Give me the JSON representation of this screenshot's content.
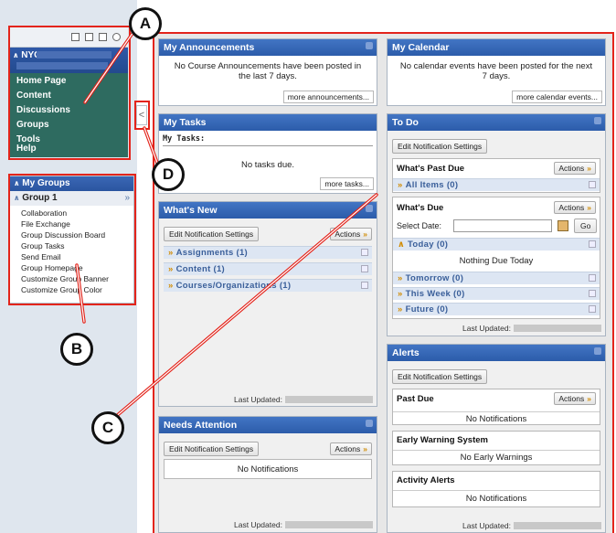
{
  "sidebar": {
    "course_title": "NYC",
    "menu_items": [
      "Home Page",
      "Content",
      "Discussions",
      "Groups",
      "Tools",
      "Help"
    ],
    "collapse_glyph": "<"
  },
  "groups": {
    "header": "My Groups",
    "group_name": "Group 1",
    "group_chevron": "»",
    "links": [
      "Collaboration",
      "File Exchange",
      "Group Discussion Board",
      "Group Tasks",
      "Send Email",
      "Group Homepage",
      "Customize Group Banner",
      "Customize Group Color"
    ]
  },
  "announcements": {
    "title": "My Announcements",
    "message": "No Course Announcements have been posted in the last 7 days.",
    "more": "more announcements..."
  },
  "calendar": {
    "title": "My Calendar",
    "message": "No calendar events have been posted for the next 7 days.",
    "more": "more calendar events..."
  },
  "tasks": {
    "title": "My Tasks",
    "subtitle": "My Tasks:",
    "message": "No tasks due.",
    "more": "more tasks..."
  },
  "whats_new": {
    "title": "What's New",
    "edit_button": "Edit Notification Settings",
    "actions": "Actions",
    "filters": [
      "Assignments (1)",
      "Content (1)",
      "Courses/Organizations (1)"
    ],
    "last_updated": "Last Updated:"
  },
  "needs_attention": {
    "title": "Needs Attention",
    "edit_button": "Edit Notification Settings",
    "actions": "Actions",
    "message": "No Notifications",
    "last_updated": "Last Updated:"
  },
  "todo": {
    "title": "To Do",
    "edit_button": "Edit Notification Settings",
    "past_due_title": "What's Past Due",
    "actions": "Actions",
    "all_items": "All Items (0)",
    "whats_due_title": "What's Due",
    "select_date_label": "Select Date:",
    "go_button": "Go",
    "today": "Today (0)",
    "nothing_due": "Nothing Due Today",
    "tomorrow": "Tomorrow (0)",
    "this_week": "This Week (0)",
    "future": "Future (0)",
    "last_updated": "Last Updated:"
  },
  "alerts": {
    "title": "Alerts",
    "edit_button": "Edit Notification Settings",
    "past_due_title": "Past Due",
    "actions": "Actions",
    "past_due_message": "No Notifications",
    "early_warning_title": "Early Warning System",
    "early_warning_message": "No Early Warnings",
    "activity_title": "Activity Alerts",
    "activity_message": "No Notifications",
    "last_updated": "Last Updated:"
  },
  "callouts": {
    "a": "A",
    "b": "B",
    "c": "C",
    "d": "D"
  },
  "colors": {
    "annotation_red": "#e3241b",
    "header_blue": "#2c5caa",
    "menu_green": "#2e6b60",
    "filter_blue": "#3a5f9a",
    "actions_chevron": "#d18b00"
  }
}
